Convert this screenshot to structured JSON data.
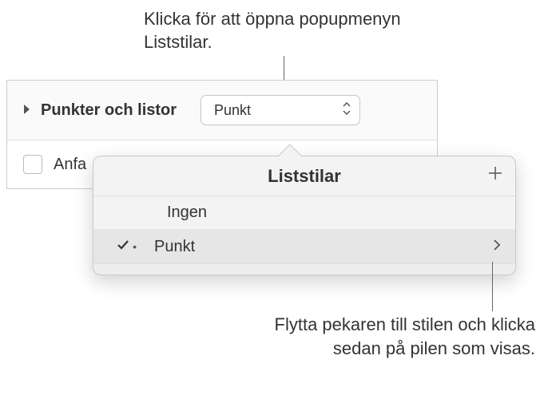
{
  "callouts": {
    "top": "Klicka för att öppna popupmenyn Liststilar.",
    "bottom": "Flytta pekaren till stilen och klicka sedan på pilen som visas."
  },
  "panel": {
    "section_label": "Punkter och listor",
    "dropdown_value": "Punkt",
    "checkbox_label": "Anfa"
  },
  "popover": {
    "title": "Liststilar",
    "items": [
      {
        "label": "Ingen",
        "selected": false
      },
      {
        "label": "Punkt",
        "selected": true
      }
    ]
  }
}
